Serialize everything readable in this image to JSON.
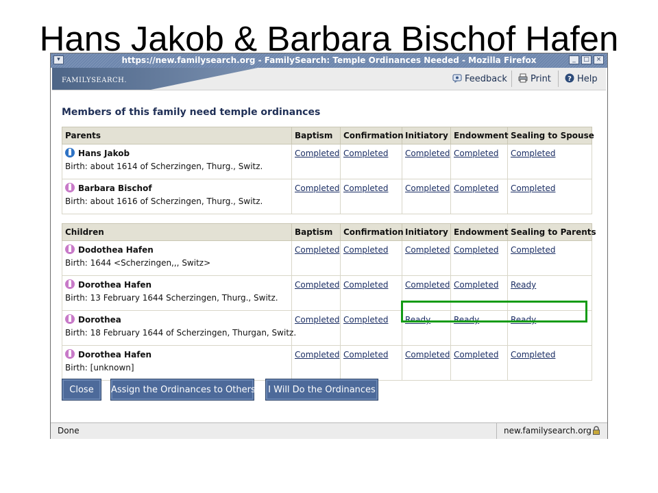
{
  "slide": {
    "title": "Hans Jakob & Barbara Bischof Hafen"
  },
  "window": {
    "title": "https://new.familysearch.org - FamilySearch: Temple Ordinances Needed - Mozilla Firefox",
    "menu_glyph": "▾",
    "minimize_glyph": "_",
    "maximize_glyph": "□",
    "close_glyph": "×"
  },
  "header": {
    "logo": "FAMILYSEARCH.",
    "feedback_label": "Feedback",
    "print_label": "Print",
    "help_label": "Help"
  },
  "main": {
    "heading": "Members of this family need temple ordinances",
    "parents_table": {
      "headers": [
        "Parents",
        "Baptism",
        "Confirmation",
        "Initiatory",
        "Endowment",
        "Sealing to Spouse"
      ],
      "rows": [
        {
          "gender": "male",
          "name": "Hans Jakob",
          "birth": "Birth: about 1614 of Scherzingen, Thurg., Switz.",
          "ordinances": [
            "Completed",
            "Completed",
            "Completed",
            "Completed",
            "Completed"
          ]
        },
        {
          "gender": "female",
          "name": "Barbara Bischof",
          "birth": "Birth: about 1616 of Scherzingen, Thurg., Switz.",
          "ordinances": [
            "Completed",
            "Completed",
            "Completed",
            "Completed",
            "Completed"
          ]
        }
      ]
    },
    "children_table": {
      "headers": [
        "Children",
        "Baptism",
        "Confirmation",
        "Initiatory",
        "Endowment",
        "Sealing to Parents"
      ],
      "rows": [
        {
          "gender": "female",
          "name": "Dodothea Hafen",
          "birth": "Birth: 1644 <Scherzingen,,, Switz>",
          "ordinances": [
            "Completed",
            "Completed",
            "Completed",
            "Completed",
            "Completed"
          ]
        },
        {
          "gender": "female",
          "name": "Dorothea Hafen",
          "birth": "Birth: 13 February 1644 Scherzingen, Thurg., Switz.",
          "ordinances": [
            "Completed",
            "Completed",
            "Completed",
            "Completed",
            "Ready"
          ]
        },
        {
          "gender": "female",
          "name": "Dorothea",
          "birth": "Birth: 18 February 1644 of Scherzingen, Thurgan, Switz.",
          "ordinances": [
            "Completed",
            "Completed",
            "Ready",
            "Ready",
            "Ready"
          ]
        },
        {
          "gender": "female",
          "name": "Dorothea Hafen",
          "birth": "Birth: [unknown]",
          "ordinances": [
            "Completed",
            "Completed",
            "Completed",
            "Completed",
            "Completed"
          ]
        }
      ]
    },
    "buttons": {
      "close": "Close",
      "assign": "Assign the Ordinances to Others",
      "do": "I Will Do the Ordinances"
    }
  },
  "status": {
    "left": "Done",
    "right": "new.familysearch.org"
  },
  "colors": {
    "titlebar": "#6d86ad",
    "button": "#4d6a9a",
    "table_header": "#e3e1d4",
    "highlight": "#139b14",
    "male_icon": "#2f73c4",
    "female_icon": "#c87ac8"
  }
}
